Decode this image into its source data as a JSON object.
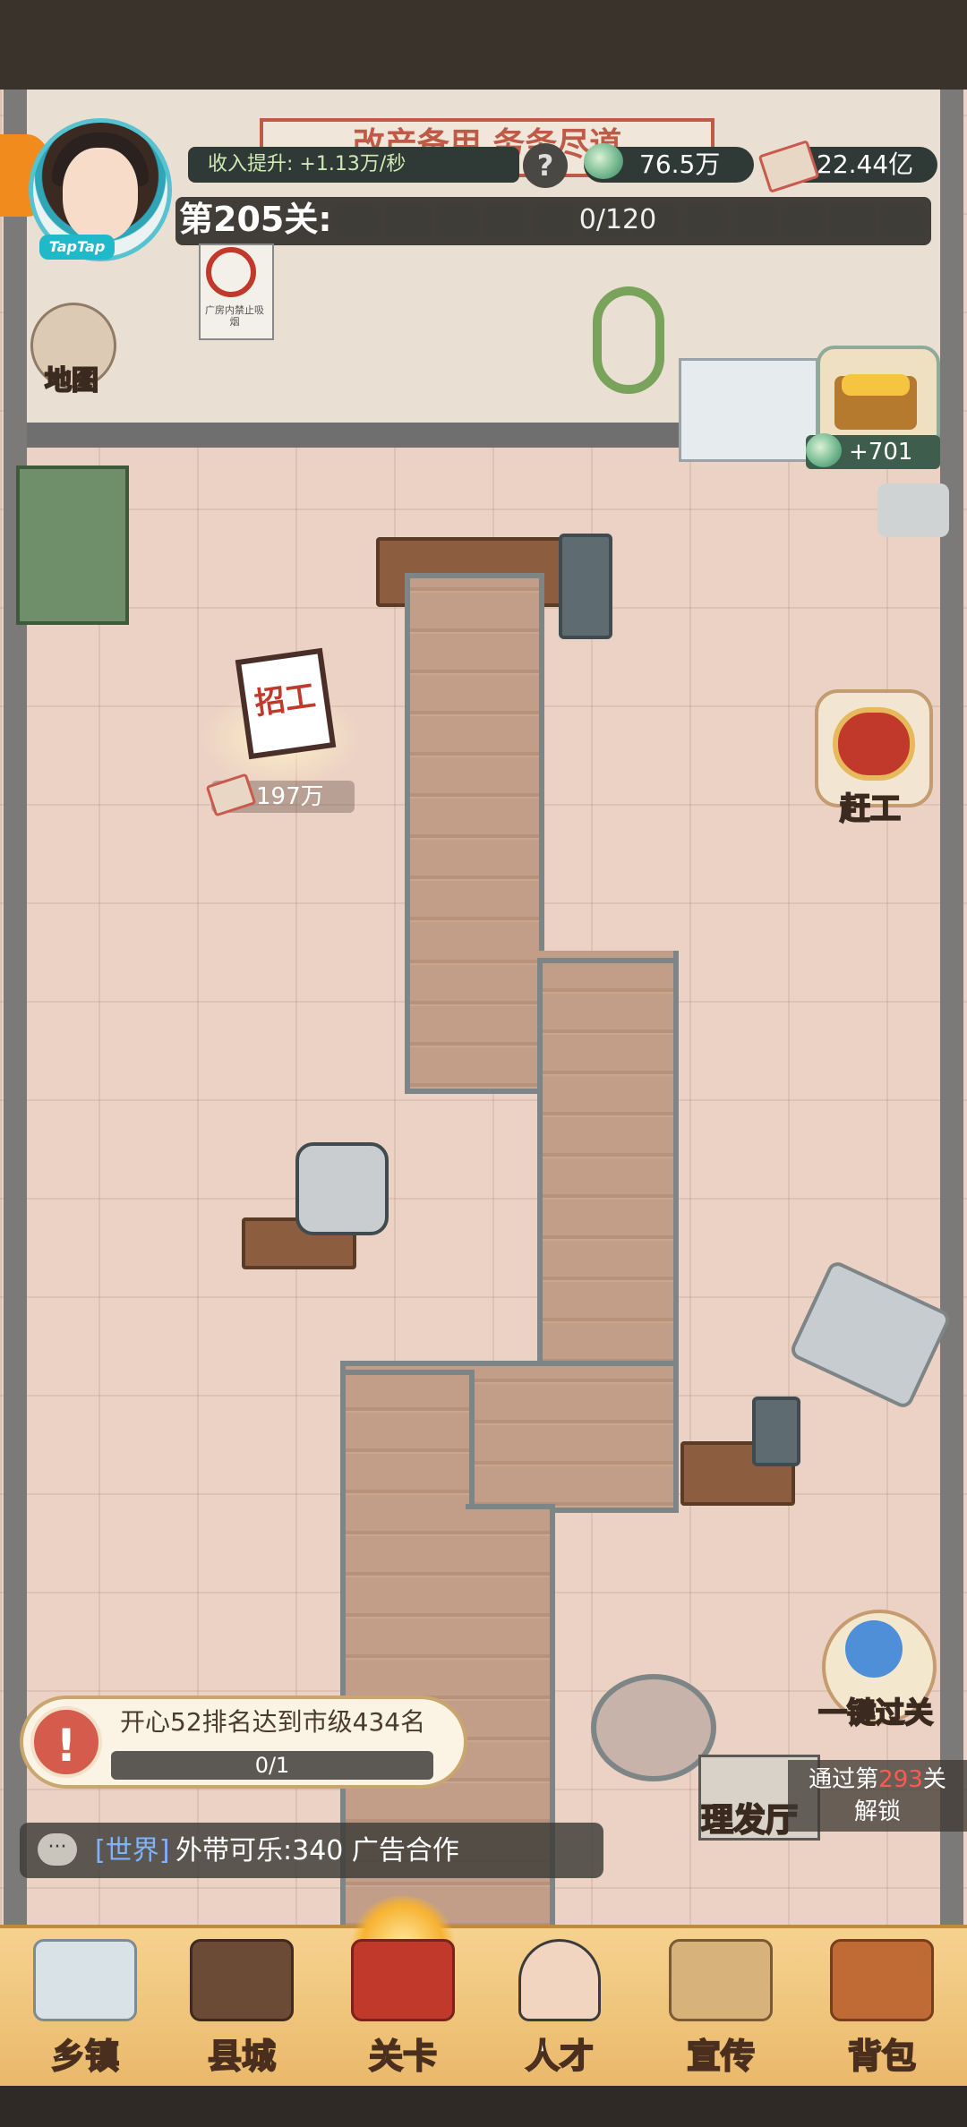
{
  "wall": {
    "slogan": "改产备用 务务尽道"
  },
  "hud": {
    "income_label": "收入提升: +1.13万/秒",
    "help_symbol": "?",
    "jade_amount": "76.5万",
    "cash_amount": "22.44亿",
    "level_label": "第205关:",
    "progress_text": "0/120",
    "progress": {
      "current": 0,
      "total": 120
    },
    "avatar_badge": "TapTap"
  },
  "map_button": {
    "label": "地图"
  },
  "no_smoking_sign": {
    "text": "广房内禁止吸烟"
  },
  "chest": {
    "reward": "+701"
  },
  "recruit": {
    "sign": "招工",
    "cost": "197万"
  },
  "rush_button": {
    "label": "赶工"
  },
  "one_key_pass": {
    "label": "一键过关"
  },
  "barber": {
    "label": "理发厅",
    "unlock_prefix": "通过第",
    "unlock_level": "293",
    "unlock_suffix": "关",
    "unlock_line2": "解锁"
  },
  "task": {
    "icon": "!",
    "text": "开心52排名达到市级434名",
    "progress": "0/1"
  },
  "chat": {
    "icon": "···",
    "channel": "[世界]",
    "message": "外带可乐:340 广告合作"
  },
  "bottom_nav": [
    {
      "label": "乡镇",
      "icon": "house-icon"
    },
    {
      "label": "县城",
      "icon": "tv-icon"
    },
    {
      "label": "关卡",
      "icon": "sewing-machine-icon"
    },
    {
      "label": "人才",
      "icon": "person-icon"
    },
    {
      "label": "宣传",
      "icon": "camera-icon"
    },
    {
      "label": "背包",
      "icon": "bag-icon"
    }
  ],
  "colors": {
    "accent_red": "#c0392b",
    "hud_dark": "#2f3a36",
    "nav_gold": "#f6d28f",
    "chat_channel": "#7fb3ff"
  }
}
